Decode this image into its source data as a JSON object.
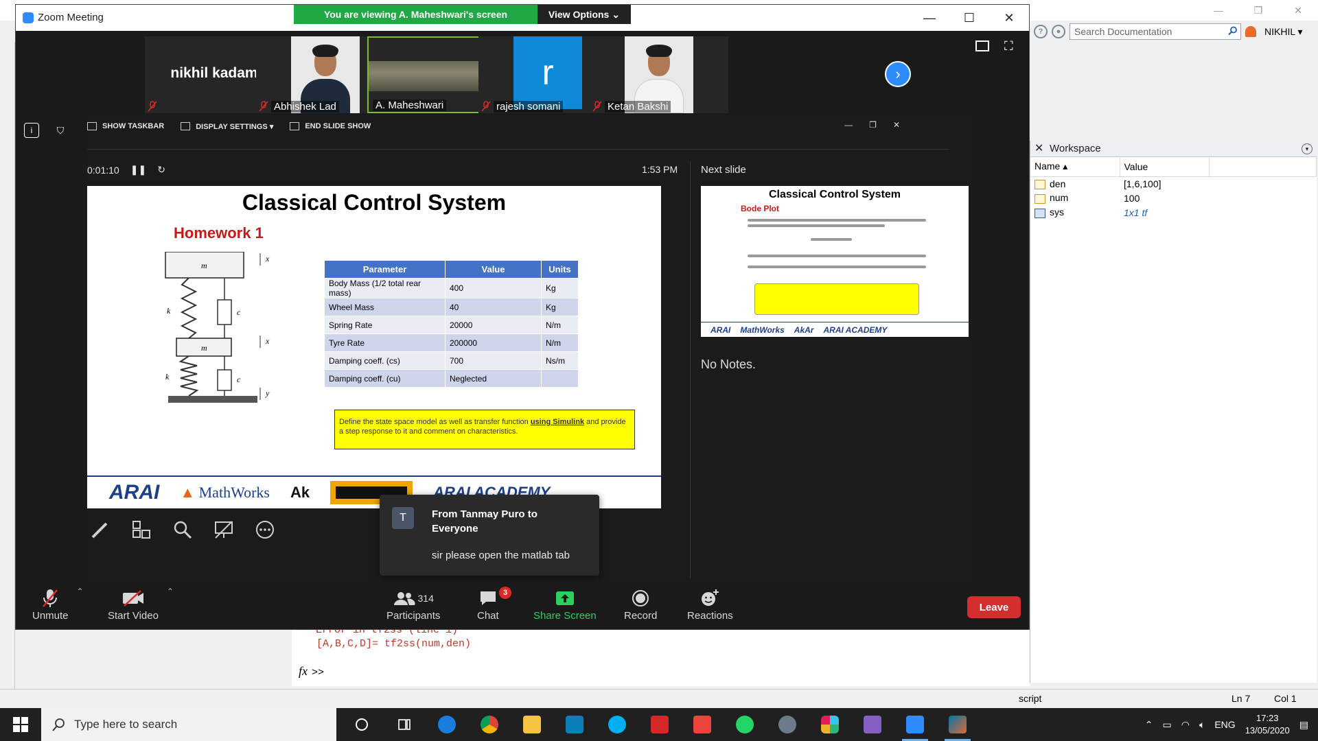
{
  "matlab": {
    "search_placeholder": "Search Documentation",
    "user": "NIKHIL",
    "workspace": {
      "title": "Workspace",
      "columns": [
        "Name",
        "Value"
      ],
      "rows": [
        {
          "name": "den",
          "value": "[1,6,100]"
        },
        {
          "name": "num",
          "value": "100"
        },
        {
          "name": "sys",
          "value": "1x1 tf"
        }
      ]
    },
    "command": {
      "error_text": "Error in tf2ss (line 1)",
      "code_line": "[A,B,C,D]= tf2ss(num,den)",
      "prompt": ">>",
      "fx": "fx"
    },
    "status": {
      "mode": "script",
      "ln_label": "Ln  7",
      "col_label": "Col  1"
    }
  },
  "zoom": {
    "window_title": "Zoom Meeting",
    "banner": "You are viewing A. Maheshwari's screen",
    "view_options": "View Options",
    "participants_strip": [
      {
        "name": "nikhil kadam",
        "type": "name-only"
      },
      {
        "name": "Abhishek Lad",
        "type": "photo",
        "muted": true
      },
      {
        "name": "A. Maheshwari",
        "type": "screen",
        "active": true
      },
      {
        "name": "rajesh somani",
        "type": "initial",
        "initial": "r",
        "muted": true
      },
      {
        "name": "Ketan Bakshi",
        "type": "photo",
        "muted": true
      }
    ],
    "presenter_tools": {
      "show_taskbar": "SHOW TASKBAR",
      "display_settings": "DISPLAY SETTINGS ▾",
      "end_slide_show": "END SLIDE SHOW"
    },
    "timer": "0:01:10",
    "clock": "1:53 PM",
    "next_slide_label": "Next slide",
    "notes": "No Notes.",
    "slide": {
      "title": "Classical Control System",
      "subtitle": "Homework 1",
      "diagram_labels": {
        "ms": "m",
        "mu": "m",
        "ks": "k",
        "ku": "k",
        "cs": "c",
        "cu": "c",
        "xs": "x",
        "xu": "x",
        "y": "y"
      },
      "table": {
        "headers": [
          "Parameter",
          "Value",
          "Units"
        ],
        "rows": [
          [
            "Body Mass (1/2 total rear mass)",
            "400",
            "Kg"
          ],
          [
            "Wheel Mass",
            "40",
            "Kg"
          ],
          [
            "Spring Rate",
            "20000",
            "N/m"
          ],
          [
            "Tyre Rate",
            "200000",
            "N/m"
          ],
          [
            "Damping coeff. (cs)",
            "700",
            "Ns/m"
          ],
          [
            "Damping coeff. (cu)",
            "Neglected",
            ""
          ]
        ]
      },
      "task_pre": "Define the state space model as well as transfer function ",
      "task_link": "using Simulink",
      "task_post": " and provide a step response to it and comment on characteristics.",
      "logos": {
        "arai": "ARAI",
        "mathworks": "MathWorks",
        "akar": "Ak",
        "academy": "ARAI ACADEMY"
      }
    },
    "next_slide": {
      "title": "Classical Control System",
      "subtitle": "Bode Plot",
      "logos": [
        "ARAI",
        "MathWorks",
        "AkAr",
        "ARAI ACADEMY"
      ]
    },
    "chat_popup": {
      "avatar": "T",
      "from": "From Tanmay Puro to Everyone",
      "message": "sir please open the matlab tab"
    },
    "controls": {
      "unmute": "Unmute",
      "start_video": "Start Video",
      "participants": "Participants",
      "participants_count": "314",
      "chat": "Chat",
      "chat_badge": "3",
      "share_screen": "Share Screen",
      "record": "Record",
      "reactions": "Reactions",
      "leave": "Leave"
    }
  },
  "taskbar": {
    "search_placeholder": "Type here to search",
    "language": "ENG",
    "time": "17:23",
    "date": "13/05/2020"
  },
  "colors": {
    "zoom_blue": "#2d8cff",
    "banner_green": "#1fa843",
    "leave_red": "#d32f2f",
    "slide_table_header": "#4472c4",
    "slide_heading_red": "#c41a1a"
  }
}
